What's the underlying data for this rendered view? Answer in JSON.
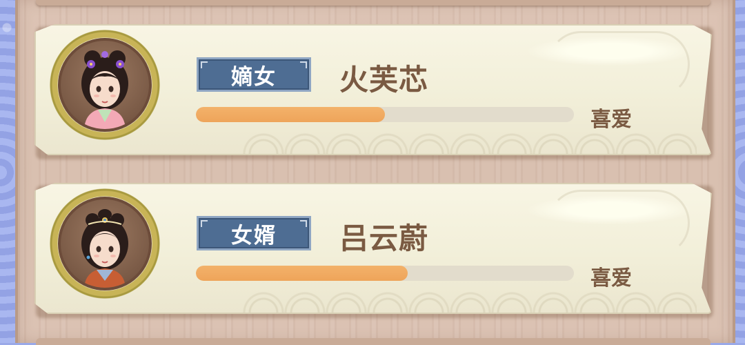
{
  "relationships": [
    {
      "title": "嫡女",
      "name": "火芙芯",
      "status": "喜爱",
      "affection_progress": 0.5,
      "portrait": "noble-lady-purple-flowers-portrait"
    },
    {
      "title": "女婿",
      "name": "吕云蔚",
      "status": "喜爱",
      "affection_progress": 0.56,
      "portrait": "young-man-topknot-portrait"
    }
  ],
  "colors": {
    "title_badge": "#4e6d93",
    "name_text": "#7a5a42",
    "bar_fill": "#eea45a",
    "bar_track": "#e2dccc",
    "card_bg": "#f5f2de",
    "wood": "#dbc2b3",
    "outer_bg": "#98a7e8"
  }
}
